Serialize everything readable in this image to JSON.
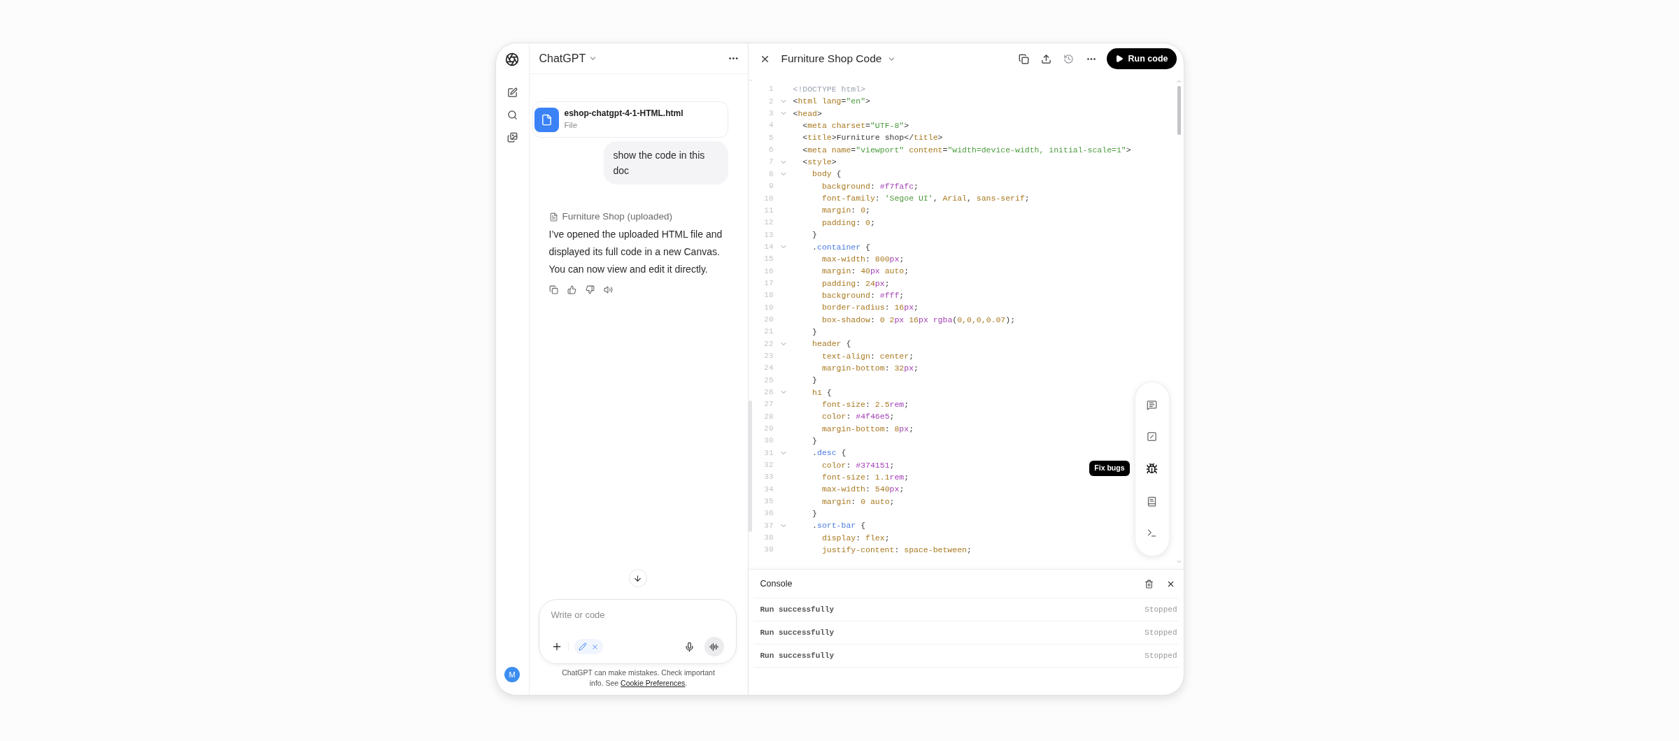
{
  "rail": {
    "avatar": "M"
  },
  "chat": {
    "title": "ChatGPT",
    "attachment": {
      "name": "eshop-chatgpt-4-1-HTML.html",
      "type": "File"
    },
    "user_message": "show the code in this doc",
    "assistant": {
      "canvas_ref": "Furniture Shop (uploaded)",
      "text": "I’ve opened the uploaded HTML file and displayed its full code in a new Canvas. You can now view and edit it directly."
    },
    "composer": {
      "placeholder": "Write or code"
    },
    "footer": {
      "text": "ChatGPT can make mistakes. Check important info. See",
      "link": "Cookie Preferences",
      "end": "."
    }
  },
  "editor": {
    "title": "Furniture Shop Code",
    "run_button": "Run code",
    "tooltip": "Fix bugs",
    "lines": [
      {
        "number": "1",
        "foldable": false,
        "tokens": [
          {
            "text": "<!DOCTYPE html>",
            "kind": "doctype"
          }
        ]
      },
      {
        "number": "2",
        "foldable": true,
        "tokens": [
          {
            "text": "<",
            "kind": "punct"
          },
          {
            "text": "html",
            "kind": "keyword"
          },
          {
            "text": " lang",
            "kind": "keyword"
          },
          {
            "text": "=",
            "kind": "punct"
          },
          {
            "text": "\"en\"",
            "kind": "string"
          },
          {
            "text": ">",
            "kind": "punct"
          }
        ]
      },
      {
        "number": "3",
        "foldable": true,
        "tokens": [
          {
            "text": "<",
            "kind": "punct"
          },
          {
            "text": "head",
            "kind": "keyword"
          },
          {
            "text": ">",
            "kind": "punct"
          }
        ]
      },
      {
        "number": "4",
        "foldable": false,
        "tokens": [
          {
            "text": "  <",
            "kind": "punct"
          },
          {
            "text": "meta",
            "kind": "keyword"
          },
          {
            "text": " charset",
            "kind": "keyword"
          },
          {
            "text": "=",
            "kind": "punct"
          },
          {
            "text": "\"UTF-8\"",
            "kind": "string"
          },
          {
            "text": ">",
            "kind": "punct"
          }
        ]
      },
      {
        "number": "5",
        "foldable": false,
        "tokens": [
          {
            "text": "  <",
            "kind": "punct"
          },
          {
            "text": "title",
            "kind": "keyword"
          },
          {
            "text": ">Furniture shop</",
            "kind": "punct"
          },
          {
            "text": "title",
            "kind": "keyword"
          },
          {
            "text": ">",
            "kind": "punct"
          }
        ]
      },
      {
        "number": "6",
        "foldable": false,
        "tokens": [
          {
            "text": "  <",
            "kind": "punct"
          },
          {
            "text": "meta",
            "kind": "keyword"
          },
          {
            "text": " name",
            "kind": "keyword"
          },
          {
            "text": "=",
            "kind": "punct"
          },
          {
            "text": "\"viewport\"",
            "kind": "string"
          },
          {
            "text": " content",
            "kind": "keyword"
          },
          {
            "text": "=",
            "kind": "punct"
          },
          {
            "text": "\"width=device-width, initial-scale=1\"",
            "kind": "string"
          },
          {
            "text": ">",
            "kind": "punct"
          }
        ]
      },
      {
        "number": "7",
        "foldable": true,
        "tokens": [
          {
            "text": "  <",
            "kind": "punct"
          },
          {
            "text": "style",
            "kind": "keyword"
          },
          {
            "text": ">",
            "kind": "punct"
          }
        ]
      },
      {
        "number": "8",
        "foldable": true,
        "tokens": [
          {
            "text": "    body",
            "kind": "keyword"
          },
          {
            "text": " {",
            "kind": "punct"
          }
        ]
      },
      {
        "number": "9",
        "foldable": false,
        "tokens": [
          {
            "text": "      background",
            "kind": "keyword"
          },
          {
            "text": ": ",
            "kind": "punct"
          },
          {
            "text": "#f7fafc",
            "kind": "number"
          },
          {
            "text": ";",
            "kind": "punct"
          }
        ]
      },
      {
        "number": "10",
        "foldable": false,
        "tokens": [
          {
            "text": "      font-family",
            "kind": "keyword"
          },
          {
            "text": ": ",
            "kind": "punct"
          },
          {
            "text": "'Segoe UI'",
            "kind": "string"
          },
          {
            "text": ", ",
            "kind": "punct"
          },
          {
            "text": "Arial",
            "kind": "keyword"
          },
          {
            "text": ", ",
            "kind": "punct"
          },
          {
            "text": "sans-serif",
            "kind": "keyword"
          },
          {
            "text": ";",
            "kind": "punct"
          }
        ]
      },
      {
        "number": "11",
        "foldable": false,
        "tokens": [
          {
            "text": "      margin",
            "kind": "keyword"
          },
          {
            "text": ": ",
            "kind": "punct"
          },
          {
            "text": "0",
            "kind": "keyword"
          },
          {
            "text": ";",
            "kind": "punct"
          }
        ]
      },
      {
        "number": "12",
        "foldable": false,
        "tokens": [
          {
            "text": "      padding",
            "kind": "keyword"
          },
          {
            "text": ": ",
            "kind": "punct"
          },
          {
            "text": "0",
            "kind": "keyword"
          },
          {
            "text": ";",
            "kind": "punct"
          }
        ]
      },
      {
        "number": "13",
        "foldable": false,
        "tokens": [
          {
            "text": "    }",
            "kind": "punct"
          }
        ]
      },
      {
        "number": "14",
        "foldable": true,
        "tokens": [
          {
            "text": "    .",
            "kind": "punct"
          },
          {
            "text": "container",
            "kind": "class"
          },
          {
            "text": " {",
            "kind": "punct"
          }
        ]
      },
      {
        "number": "15",
        "foldable": false,
        "tokens": [
          {
            "text": "      max-width",
            "kind": "keyword"
          },
          {
            "text": ": ",
            "kind": "punct"
          },
          {
            "text": "800",
            "kind": "keyword"
          },
          {
            "text": "px",
            "kind": "number"
          },
          {
            "text": ";",
            "kind": "punct"
          }
        ]
      },
      {
        "number": "16",
        "foldable": false,
        "tokens": [
          {
            "text": "      margin",
            "kind": "keyword"
          },
          {
            "text": ": ",
            "kind": "punct"
          },
          {
            "text": "40",
            "kind": "keyword"
          },
          {
            "text": "px",
            "kind": "number"
          },
          {
            "text": " auto",
            "kind": "keyword"
          },
          {
            "text": ";",
            "kind": "punct"
          }
        ]
      },
      {
        "number": "17",
        "foldable": false,
        "tokens": [
          {
            "text": "      padding",
            "kind": "keyword"
          },
          {
            "text": ": ",
            "kind": "punct"
          },
          {
            "text": "24",
            "kind": "keyword"
          },
          {
            "text": "px",
            "kind": "number"
          },
          {
            "text": ";",
            "kind": "punct"
          }
        ]
      },
      {
        "number": "18",
        "foldable": false,
        "tokens": [
          {
            "text": "      background",
            "kind": "keyword"
          },
          {
            "text": ": ",
            "kind": "punct"
          },
          {
            "text": "#fff",
            "kind": "number"
          },
          {
            "text": ";",
            "kind": "punct"
          }
        ]
      },
      {
        "number": "19",
        "foldable": false,
        "tokens": [
          {
            "text": "      border-radius",
            "kind": "keyword"
          },
          {
            "text": ": ",
            "kind": "punct"
          },
          {
            "text": "16",
            "kind": "keyword"
          },
          {
            "text": "px",
            "kind": "number"
          },
          {
            "text": ";",
            "kind": "punct"
          }
        ]
      },
      {
        "number": "20",
        "foldable": false,
        "tokens": [
          {
            "text": "      box-shadow",
            "kind": "keyword"
          },
          {
            "text": ": ",
            "kind": "punct"
          },
          {
            "text": "0 2",
            "kind": "keyword"
          },
          {
            "text": "px",
            "kind": "number"
          },
          {
            "text": " 16",
            "kind": "keyword"
          },
          {
            "text": "px",
            "kind": "number"
          },
          {
            "text": " rgba",
            "kind": "number"
          },
          {
            "text": "(",
            "kind": "punct"
          },
          {
            "text": "0,0,0,0.07",
            "kind": "keyword"
          },
          {
            "text": ");",
            "kind": "punct"
          }
        ]
      },
      {
        "number": "21",
        "foldable": false,
        "tokens": [
          {
            "text": "    }",
            "kind": "punct"
          }
        ]
      },
      {
        "number": "22",
        "foldable": true,
        "tokens": [
          {
            "text": "    header",
            "kind": "keyword"
          },
          {
            "text": " {",
            "kind": "punct"
          }
        ]
      },
      {
        "number": "23",
        "foldable": false,
        "tokens": [
          {
            "text": "      text-align",
            "kind": "keyword"
          },
          {
            "text": ": ",
            "kind": "punct"
          },
          {
            "text": "center",
            "kind": "keyword"
          },
          {
            "text": ";",
            "kind": "punct"
          }
        ]
      },
      {
        "number": "24",
        "foldable": false,
        "tokens": [
          {
            "text": "      margin-bottom",
            "kind": "keyword"
          },
          {
            "text": ": ",
            "kind": "punct"
          },
          {
            "text": "32",
            "kind": "keyword"
          },
          {
            "text": "px",
            "kind": "number"
          },
          {
            "text": ";",
            "kind": "punct"
          }
        ]
      },
      {
        "number": "25",
        "foldable": false,
        "tokens": [
          {
            "text": "    }",
            "kind": "punct"
          }
        ]
      },
      {
        "number": "26",
        "foldable": true,
        "tokens": [
          {
            "text": "    h1",
            "kind": "keyword"
          },
          {
            "text": " {",
            "kind": "punct"
          }
        ]
      },
      {
        "number": "27",
        "foldable": false,
        "tokens": [
          {
            "text": "      font-size",
            "kind": "keyword"
          },
          {
            "text": ": ",
            "kind": "punct"
          },
          {
            "text": "2.5",
            "kind": "keyword"
          },
          {
            "text": "rem",
            "kind": "number"
          },
          {
            "text": ";",
            "kind": "punct"
          }
        ]
      },
      {
        "number": "28",
        "foldable": false,
        "tokens": [
          {
            "text": "      color",
            "kind": "keyword"
          },
          {
            "text": ": ",
            "kind": "punct"
          },
          {
            "text": "#4f46e5",
            "kind": "number"
          },
          {
            "text": ";",
            "kind": "punct"
          }
        ]
      },
      {
        "number": "29",
        "foldable": false,
        "tokens": [
          {
            "text": "      margin-bottom",
            "kind": "keyword"
          },
          {
            "text": ": ",
            "kind": "punct"
          },
          {
            "text": "8",
            "kind": "keyword"
          },
          {
            "text": "px",
            "kind": "number"
          },
          {
            "text": ";",
            "kind": "punct"
          }
        ]
      },
      {
        "number": "30",
        "foldable": false,
        "tokens": [
          {
            "text": "    }",
            "kind": "punct"
          }
        ]
      },
      {
        "number": "31",
        "foldable": true,
        "tokens": [
          {
            "text": "    .",
            "kind": "punct"
          },
          {
            "text": "desc",
            "kind": "class"
          },
          {
            "text": " {",
            "kind": "punct"
          }
        ]
      },
      {
        "number": "32",
        "foldable": false,
        "tokens": [
          {
            "text": "      color",
            "kind": "keyword"
          },
          {
            "text": ": ",
            "kind": "punct"
          },
          {
            "text": "#374151",
            "kind": "number"
          },
          {
            "text": ";",
            "kind": "punct"
          }
        ]
      },
      {
        "number": "33",
        "foldable": false,
        "tokens": [
          {
            "text": "      font-size",
            "kind": "keyword"
          },
          {
            "text": ": ",
            "kind": "punct"
          },
          {
            "text": "1.1",
            "kind": "keyword"
          },
          {
            "text": "rem",
            "kind": "number"
          },
          {
            "text": ";",
            "kind": "punct"
          }
        ]
      },
      {
        "number": "34",
        "foldable": false,
        "tokens": [
          {
            "text": "      max-width",
            "kind": "keyword"
          },
          {
            "text": ": ",
            "kind": "punct"
          },
          {
            "text": "540",
            "kind": "keyword"
          },
          {
            "text": "px",
            "kind": "number"
          },
          {
            "text": ";",
            "kind": "punct"
          }
        ]
      },
      {
        "number": "35",
        "foldable": false,
        "tokens": [
          {
            "text": "      margin",
            "kind": "keyword"
          },
          {
            "text": ": ",
            "kind": "punct"
          },
          {
            "text": "0 auto",
            "kind": "keyword"
          },
          {
            "text": ";",
            "kind": "punct"
          }
        ]
      },
      {
        "number": "36",
        "foldable": false,
        "tokens": [
          {
            "text": "    }",
            "kind": "punct"
          }
        ]
      },
      {
        "number": "37",
        "foldable": true,
        "tokens": [
          {
            "text": "    .",
            "kind": "punct"
          },
          {
            "text": "sort-bar",
            "kind": "class"
          },
          {
            "text": " {",
            "kind": "punct"
          }
        ]
      },
      {
        "number": "38",
        "foldable": false,
        "tokens": [
          {
            "text": "      display",
            "kind": "keyword"
          },
          {
            "text": ": ",
            "kind": "punct"
          },
          {
            "text": "flex",
            "kind": "keyword"
          },
          {
            "text": ";",
            "kind": "punct"
          }
        ]
      },
      {
        "number": "39",
        "foldable": false,
        "tokens": [
          {
            "text": "      justify-content",
            "kind": "keyword"
          },
          {
            "text": ": ",
            "kind": "punct"
          },
          {
            "text": "space-between",
            "kind": "keyword"
          },
          {
            "text": ";",
            "kind": "punct"
          }
        ]
      }
    ]
  },
  "console": {
    "title": "Console",
    "entries": [
      {
        "message": "Run successfully",
        "status": "Stopped"
      },
      {
        "message": "Run successfully",
        "status": "Stopped"
      },
      {
        "message": "Run successfully",
        "status": "Stopped"
      }
    ]
  }
}
